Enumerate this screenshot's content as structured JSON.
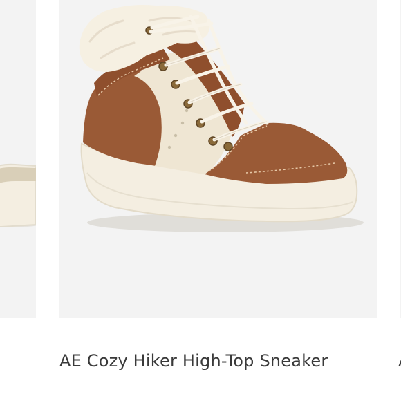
{
  "carousel": {
    "previous_card": {
      "image_alt": "product image"
    },
    "current_card": {
      "title": "AE Cozy Hiker High-Top Sneaker",
      "image_alt": "product image"
    },
    "next_card": {
      "title_fragment": "A"
    }
  },
  "colors": {
    "image_background": "#f3f3f3",
    "title_text": "#3a3a3a",
    "suede_brown": "#9a5a36",
    "canvas_cream": "#efe6d3",
    "sole_cream": "#f4eee1",
    "sherpa": "#f6f0e2",
    "lace": "#f8f3e8",
    "hardware_brass": "#8a6a3a"
  }
}
